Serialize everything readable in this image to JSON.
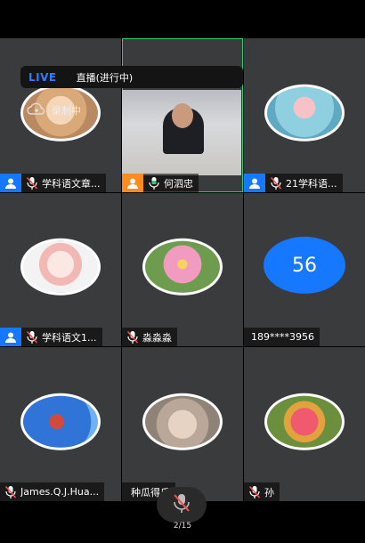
{
  "live_banner": {
    "tag": "LIVE",
    "status": "直播(进行中)"
  },
  "recording_label": "录制中",
  "participants": [
    {
      "name": "学科语文章..."
    },
    {
      "name": "何泗忠"
    },
    {
      "name": "21学科语..."
    },
    {
      "name": "学科语文1..."
    },
    {
      "name": "淼淼淼"
    },
    {
      "name": "189****3956",
      "avatar_text": "56"
    },
    {
      "name": "James.Q.J.Hua..."
    },
    {
      "name": "种瓜得瓜"
    },
    {
      "name": "孙"
    }
  ],
  "page_indicator": "2/15",
  "colors": {
    "accent": "#1677ff",
    "cohost": "#ff8a1f",
    "active_border": "#2ecc71"
  }
}
